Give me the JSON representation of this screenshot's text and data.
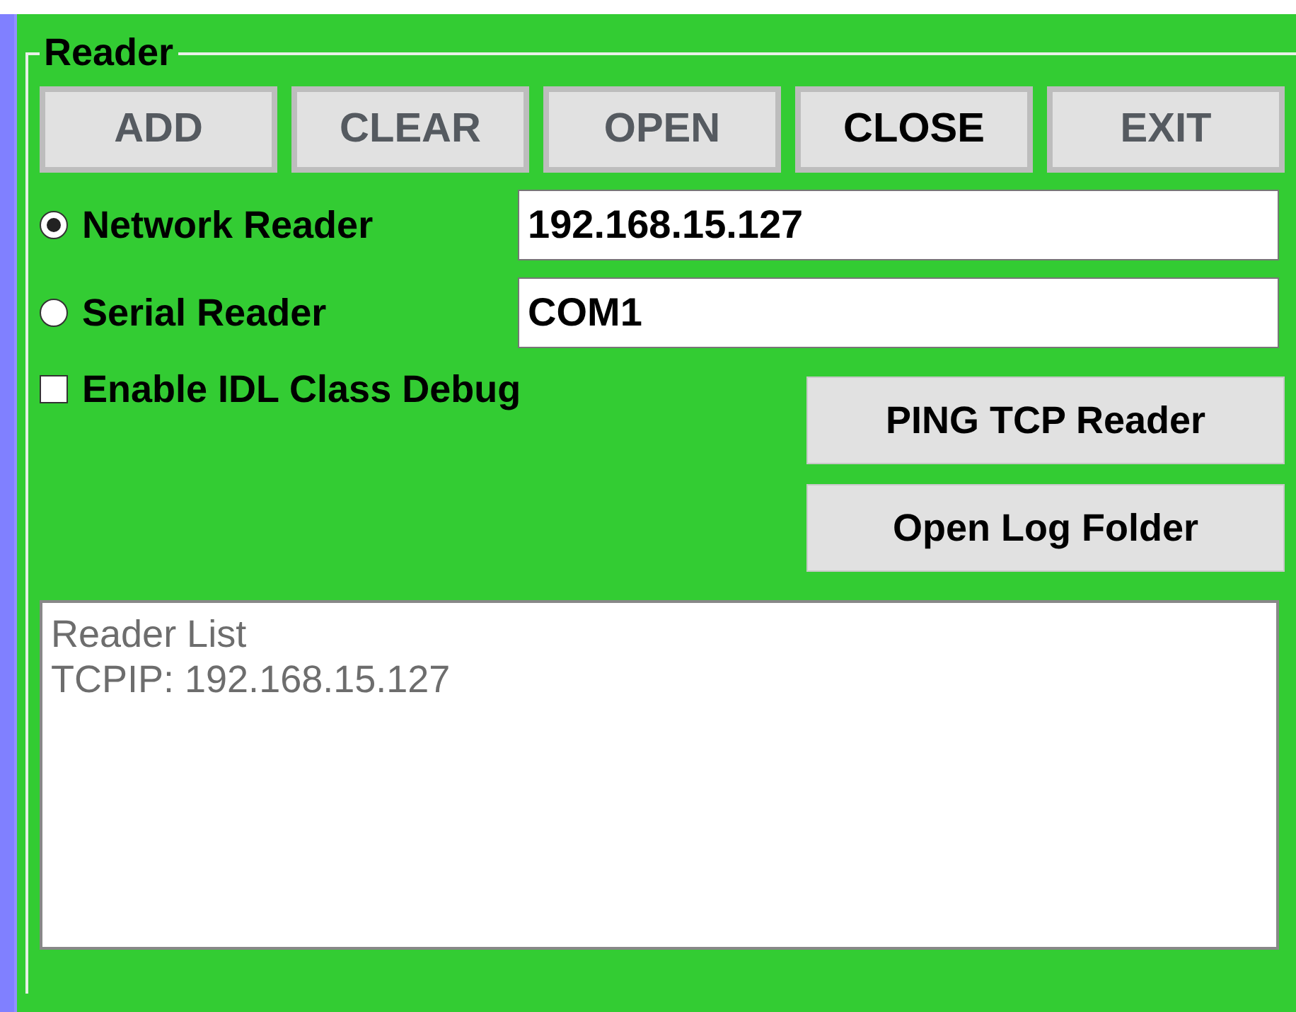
{
  "group": {
    "title": "Reader"
  },
  "buttons": [
    {
      "label": "ADD",
      "disabled": true
    },
    {
      "label": "CLEAR",
      "disabled": true
    },
    {
      "label": "OPEN",
      "disabled": true
    },
    {
      "label": "CLOSE",
      "disabled": false
    },
    {
      "label": "EXIT",
      "disabled": true
    }
  ],
  "readers": [
    {
      "label": "Network Reader",
      "selected": true,
      "value": "192.168.15.127"
    },
    {
      "label": "Serial Reader",
      "selected": false,
      "value": "COM1"
    }
  ],
  "debug": {
    "label": "Enable IDL Class Debug",
    "checked": false
  },
  "actions": [
    "PING TCP Reader",
    "Open Log Folder"
  ],
  "reader_list": [
    "Reader List",
    "TCPIP: 192.168.15.127"
  ]
}
